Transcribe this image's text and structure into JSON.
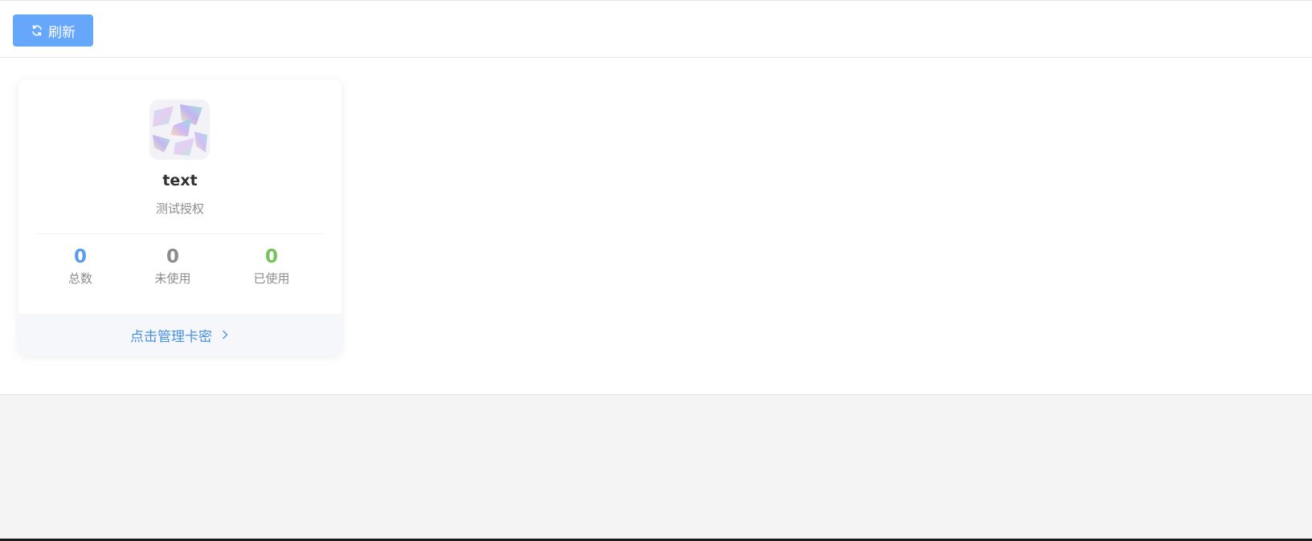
{
  "toolbar": {
    "refresh_label": "刷新",
    "refresh_icon": "refresh-icon"
  },
  "card": {
    "logo_icon": "app-logo",
    "title": "text",
    "subtitle": "测试授权",
    "stats": [
      {
        "value": "0",
        "label": "总数",
        "color": "#5b9bf0"
      },
      {
        "value": "0",
        "label": "未使用",
        "color": "#8c8c8c"
      },
      {
        "value": "0",
        "label": "已使用",
        "color": "#76c25a"
      }
    ],
    "footer_link": "点击管理卡密",
    "footer_icon": "chevron-right-icon"
  },
  "colors": {
    "accent": "#66a6fb",
    "link": "#4a90e2"
  }
}
